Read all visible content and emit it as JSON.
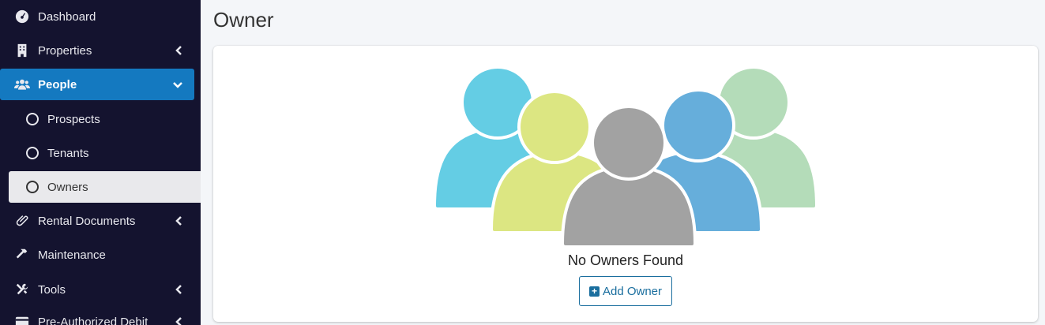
{
  "sidebar": {
    "items": [
      {
        "label": "Dashboard",
        "icon": "dashboard-icon"
      },
      {
        "label": "Properties",
        "icon": "building-icon"
      },
      {
        "label": "People",
        "icon": "users-icon"
      },
      {
        "label": "Rental Documents",
        "icon": "paperclip-icon"
      },
      {
        "label": "Maintenance",
        "icon": "hammer-icon"
      },
      {
        "label": "Tools",
        "icon": "tools-icon"
      },
      {
        "label": "Pre-Authorized Debit",
        "icon": "credit-card-icon"
      }
    ],
    "subitems": [
      {
        "label": "Prospects"
      },
      {
        "label": "Tenants"
      },
      {
        "label": "Owners"
      }
    ],
    "active_color": "#1479c0",
    "background": "#14132f"
  },
  "page": {
    "title": "Owner"
  },
  "empty_state": {
    "message": "No Owners Found",
    "add_button_label": "Add Owner",
    "illustration_colors": [
      "#64cde4",
      "#b4dcb9",
      "#dce682",
      "#66aedb",
      "#a2a2a2"
    ]
  }
}
